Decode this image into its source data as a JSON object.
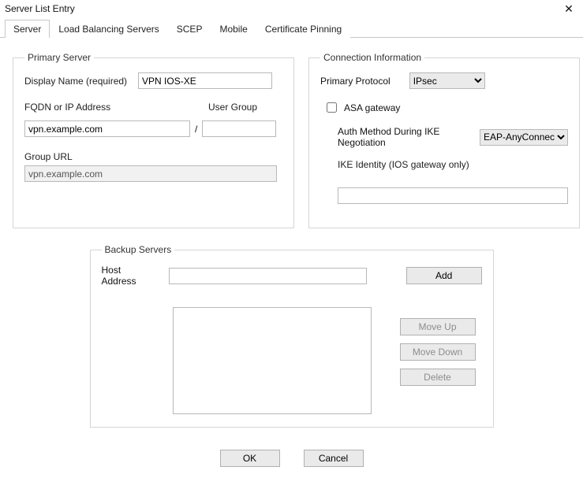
{
  "window": {
    "title": "Server List Entry"
  },
  "tabs": {
    "server": "Server",
    "lb": "Load Balancing Servers",
    "scep": "SCEP",
    "mobile": "Mobile",
    "cert": "Certificate Pinning"
  },
  "primary": {
    "legend": "Primary Server",
    "displayNameLabel": "Display Name (required)",
    "displayNameValue": "VPN IOS-XE",
    "fqdnLabel": "FQDN or IP Address",
    "fqdnValue": "vpn.example.com",
    "slash": "/",
    "userGroupLabel": "User Group",
    "userGroupValue": "",
    "groupUrlLabel": "Group URL",
    "groupUrlValue": "vpn.example.com"
  },
  "conn": {
    "legend": "Connection Information",
    "primaryProtocolLabel": "Primary Protocol",
    "primaryProtocolValue": "IPsec",
    "asaLabel": "ASA gateway",
    "asaChecked": false,
    "authLabel": "Auth Method During IKE Negotiation",
    "authValue": "EAP-AnyConnect",
    "ikeLabel": "IKE Identity (IOS gateway only)",
    "ikeValue": ""
  },
  "backup": {
    "legend": "Backup Servers",
    "hostLabel": "Host Address",
    "hostValue": "",
    "addLabel": "Add",
    "moveUpLabel": "Move Up",
    "moveDownLabel": "Move Down",
    "deleteLabel": "Delete"
  },
  "footer": {
    "ok": "OK",
    "cancel": "Cancel"
  }
}
